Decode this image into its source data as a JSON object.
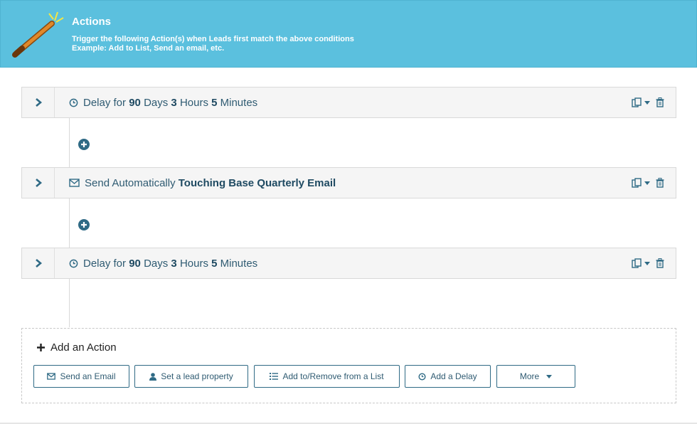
{
  "header": {
    "title": "Actions",
    "desc_line1": "Trigger the following Action(s) when Leads first match the above conditions",
    "desc_line2": "Example: Add to List, Send an email, etc."
  },
  "actions": [
    {
      "prefix": "Delay for",
      "n1": "90",
      "u1": "Days",
      "n2": "3",
      "u2": "Hours",
      "n3": "5",
      "u3": "Minutes"
    },
    {
      "prefix": "Send Automatically",
      "email_name": "Touching Base Quarterly Email"
    },
    {
      "prefix": "Delay for",
      "n1": "90",
      "u1": "Days",
      "n2": "3",
      "u2": "Hours",
      "n3": "5",
      "u3": "Minutes"
    }
  ],
  "add_action": {
    "title": "Add an Action",
    "buttons": {
      "send_email": "Send an Email",
      "set_property": "Set a lead property",
      "list": "Add to/Remove from a List",
      "delay": "Add a Delay",
      "more": "More"
    }
  },
  "colors": {
    "header_bg": "#5bc0de",
    "accent": "#2f6a85"
  }
}
